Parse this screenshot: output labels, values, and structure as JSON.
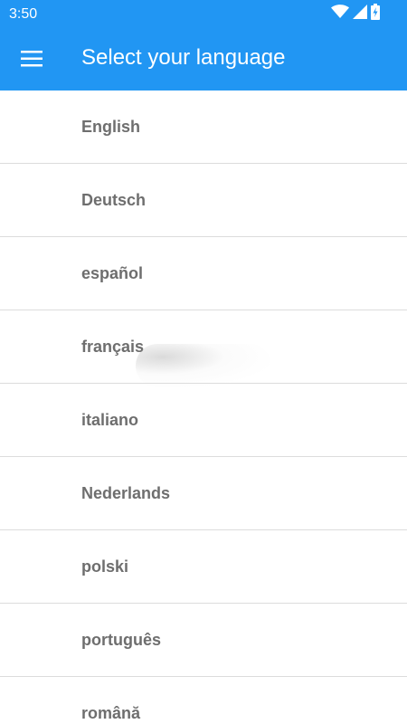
{
  "status_bar": {
    "time": "3:50",
    "icons": [
      "wifi-icon",
      "signal-icon",
      "battery-charging-icon"
    ]
  },
  "app_bar": {
    "menu_icon": "hamburger-menu-icon",
    "title": "Select your language"
  },
  "languages": [
    {
      "label": "English"
    },
    {
      "label": "Deutsch"
    },
    {
      "label": "español"
    },
    {
      "label": "français"
    },
    {
      "label": "italiano"
    },
    {
      "label": "Nederlands"
    },
    {
      "label": "polski"
    },
    {
      "label": "português"
    },
    {
      "label": "română"
    }
  ],
  "colors": {
    "app_bar": "#2196f3",
    "list_text": "#6e6e6e",
    "divider": "#dcdcdc",
    "background": "#ffffff"
  }
}
